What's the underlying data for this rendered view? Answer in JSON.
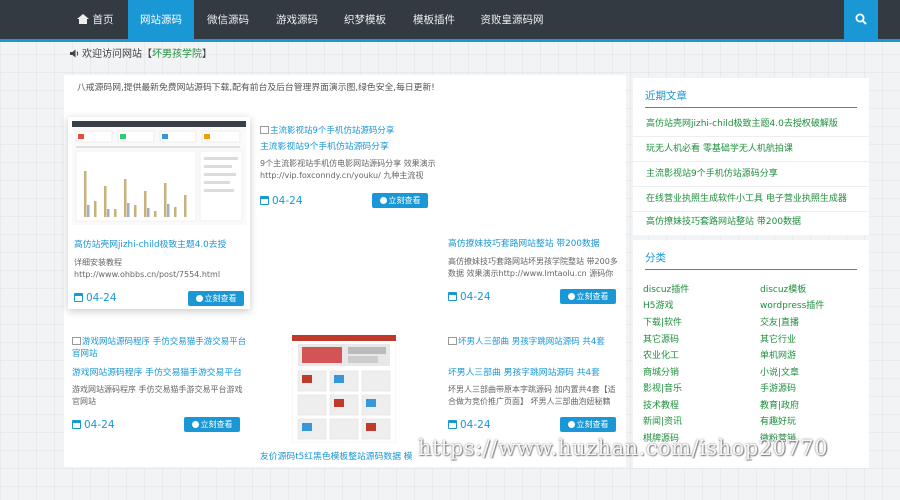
{
  "nav": {
    "items": [
      {
        "label": "首页"
      },
      {
        "label": "网站源码"
      },
      {
        "label": "微信源码"
      },
      {
        "label": "游戏源码"
      },
      {
        "label": "织梦模板"
      },
      {
        "label": "模板插件"
      },
      {
        "label": "资败皇源码网"
      }
    ],
    "active_index": 1,
    "search_icon": "search-icon"
  },
  "notice": {
    "text": "欢迎访问网站【",
    "highlight": "坏男孩学院",
    "suffix": "】"
  },
  "main": {
    "description": "八戒源码网,提供最新免费网站源码下载,配有前台及后台管理界面演示图,绿色安全,每日更新!",
    "button_label": "立刻查看",
    "cards": [
      {
        "thumb": "dashboard-screenshot",
        "title": "高仿站壳网jizhi-child极致主题4.0去授",
        "excerpt": "详细安装教程 http://www.ohbbs.cn/post/7554.html",
        "date": "04-24"
      },
      {
        "alt": "主流影视站9个手机仿站源码分享",
        "title": "主流影视站9个手机仿站源码分享",
        "excerpt": "9个主流影视站手机仿电影网站源码分享 效果演示http://vip.foxconndy.cn/youku/ 九种主流视",
        "date": "04-24"
      },
      {
        "title": "高仿撩妹技巧套路网站整站 带200数据",
        "excerpt": "高仿撩妹技巧套路网站坏男孩学院整站 带200多数据 效果演示http://www.lmtaolu.cn 源码你不错",
        "date": "04-24"
      },
      {
        "alt": "游戏网站源码程序 手仿交易猫手游交易平台官网站",
        "title": "游戏网站源码程序 手仿交易猫手游交易平台",
        "excerpt": "游戏网站源码程序 手仿交易猫手游交易平台游戏官网站",
        "date": "04-24"
      },
      {
        "thumb": "shop-screenshot",
        "title": "友价源码t5红黑色模板整站源码数据 模"
      },
      {
        "alt": "坏男人三部曲 男孩字跳网站源码 共4套",
        "title": "坏男人三部曲 男孩字跳网站源码 共4套",
        "excerpt": "坏男人三部曲带原本字跳源码 加内置共4套【适合做为竞价推广页面】 坏男人三部曲泡妞秘籍",
        "date": "04-24"
      }
    ]
  },
  "sidebar": {
    "recent_title": "近期文章",
    "recent": [
      "高仿站壳网jizhi-child极致主题4.0去授权破解版",
      "玩无人机必看 零基础学无人机航拍课",
      "主流影视站9个手机仿站源码分享",
      "在线营业执照生成软件小工具 电子营业执照生成器",
      "高仿撩妹技巧套路网站整站 带200数据"
    ],
    "category_title": "分类",
    "categories": [
      "discuz插件",
      "discuz模板",
      "H5游戏",
      "wordpress插件",
      "下载|软件",
      "交友|直播",
      "其它源码",
      "其它行业",
      "农业化工",
      "单机网游",
      "商城分销",
      "小说|文章",
      "影视|音乐",
      "手游源码",
      "技术教程",
      "教育|政府",
      "新闻|资讯",
      "有趣好玩",
      "棋牌源码",
      "微粉营销"
    ]
  },
  "watermark": "https://www.huzhan.com/ishop20770"
}
